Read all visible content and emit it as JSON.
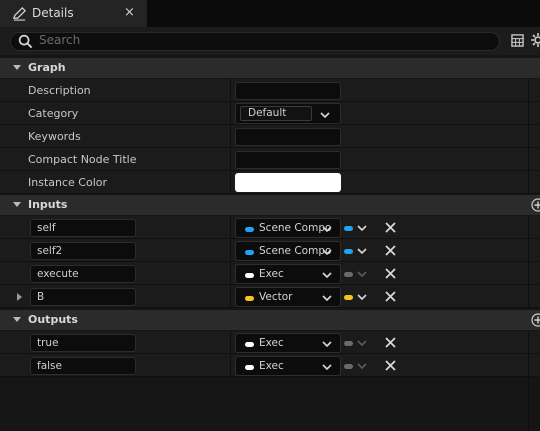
{
  "tab": {
    "title": "Details",
    "close": "×"
  },
  "search": {
    "placeholder": "Search"
  },
  "graph": {
    "title": "Graph",
    "description_label": "Description",
    "category_label": "Category",
    "category_value": "Default",
    "keywords_label": "Keywords",
    "compact_label": "Compact Node Title",
    "instance_color_label": "Instance Color",
    "instance_color": "#ffffff"
  },
  "inputs": {
    "title": "Inputs",
    "items": [
      {
        "name": "self",
        "type": "Scene Compo",
        "color": "#1ea3ef"
      },
      {
        "name": "self2",
        "type": "Scene Compo",
        "color": "#1ea3ef"
      },
      {
        "name": "execute",
        "type": "Exec",
        "color": "#ffffff"
      },
      {
        "name": "B",
        "type": "Vector",
        "color": "#f5c61b"
      }
    ]
  },
  "outputs": {
    "title": "Outputs",
    "items": [
      {
        "name": "true",
        "type": "Exec",
        "color": "#ffffff"
      },
      {
        "name": "false",
        "type": "Exec",
        "color": "#ffffff"
      }
    ]
  }
}
